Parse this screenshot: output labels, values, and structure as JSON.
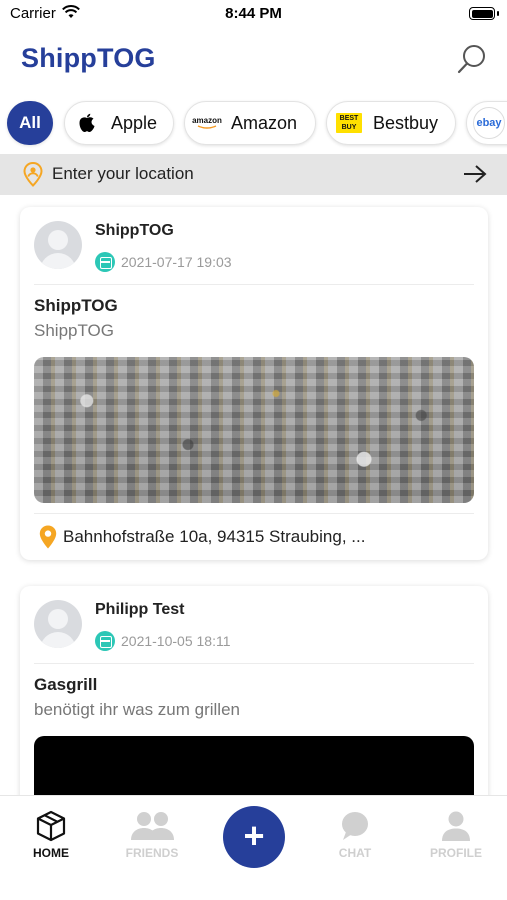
{
  "status_bar": {
    "carrier": "Carrier",
    "time": "8:44 PM"
  },
  "header": {
    "title": "ShippTOG"
  },
  "chips": [
    {
      "label": "All",
      "active": true
    },
    {
      "label": "Apple",
      "icon": "apple-logo-icon"
    },
    {
      "label": "Amazon",
      "icon": "amazon-logo-icon",
      "logo_text": "amazon"
    },
    {
      "label": "Bestbuy",
      "icon": "bestbuy-logo-icon",
      "logo_text": "BEST BUY"
    },
    {
      "label": "",
      "icon": "ebay-logo-icon",
      "logo_text": "ebay"
    }
  ],
  "location": {
    "placeholder": "Enter your location"
  },
  "posts": [
    {
      "author": "ShippTOG",
      "date": "2021-07-17 19:03",
      "title": "ShippTOG",
      "subtitle": "ShippTOG",
      "image": "granite-texture",
      "address": "Bahnhofstraße 10a, 94315 Straubing, ..."
    },
    {
      "author": "Philipp Test",
      "date": "2021-10-05 18:11",
      "title": "Gasgrill",
      "subtitle": "benötigt ihr was zum grillen",
      "image": "black"
    }
  ],
  "tabbar": {
    "home": "HOME",
    "friends": "FRIENDS",
    "add": "+",
    "chat": "CHAT",
    "profile": "PROFILE"
  },
  "colors": {
    "brand": "#263f9a",
    "date_icon": "#2cc7b6",
    "pin": "#f5a623",
    "inactive": "#cfcfcf"
  }
}
